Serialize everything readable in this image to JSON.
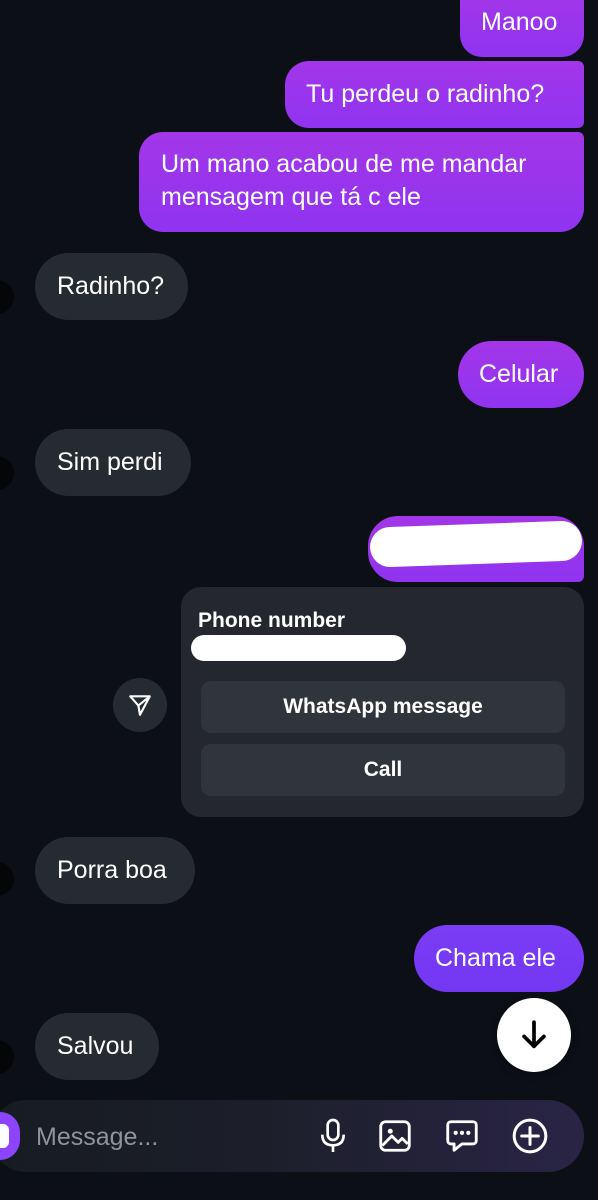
{
  "conversation": {
    "messages": [
      {
        "direction": "outgoing",
        "text": "Manoo"
      },
      {
        "direction": "outgoing",
        "text": "Tu perdeu o radinho?"
      },
      {
        "direction": "outgoing",
        "lines": [
          "Um mano acabou de me mandar",
          "mensagem que tá c ele"
        ]
      },
      {
        "direction": "incoming",
        "text": "Radinho?"
      },
      {
        "direction": "outgoing",
        "text": "Celular"
      },
      {
        "direction": "incoming",
        "text": "Sim perdi"
      },
      {
        "direction": "outgoing",
        "text": ""
      },
      {
        "direction": "incoming",
        "text": "Porra boa"
      },
      {
        "direction": "outgoing",
        "text": "Chama ele"
      },
      {
        "direction": "incoming",
        "text": "Salvou"
      }
    ],
    "phone_card": {
      "title": "Phone number",
      "whatsapp_label": "WhatsApp message",
      "call_label": "Call"
    }
  },
  "composer": {
    "placeholder": "Message..."
  },
  "icons": {
    "share": "send-icon",
    "scroll_down": "arrow-down-icon",
    "mic": "microphone-icon",
    "gallery": "image-icon",
    "sticker": "chat-bubble-icon",
    "more": "plus-circle-icon"
  },
  "colors": {
    "background": "#0c1016",
    "outgoing_bubble": "#9a35ec",
    "incoming_bubble": "#262a31",
    "text": "#ffffff",
    "placeholder": "#8e939c"
  }
}
